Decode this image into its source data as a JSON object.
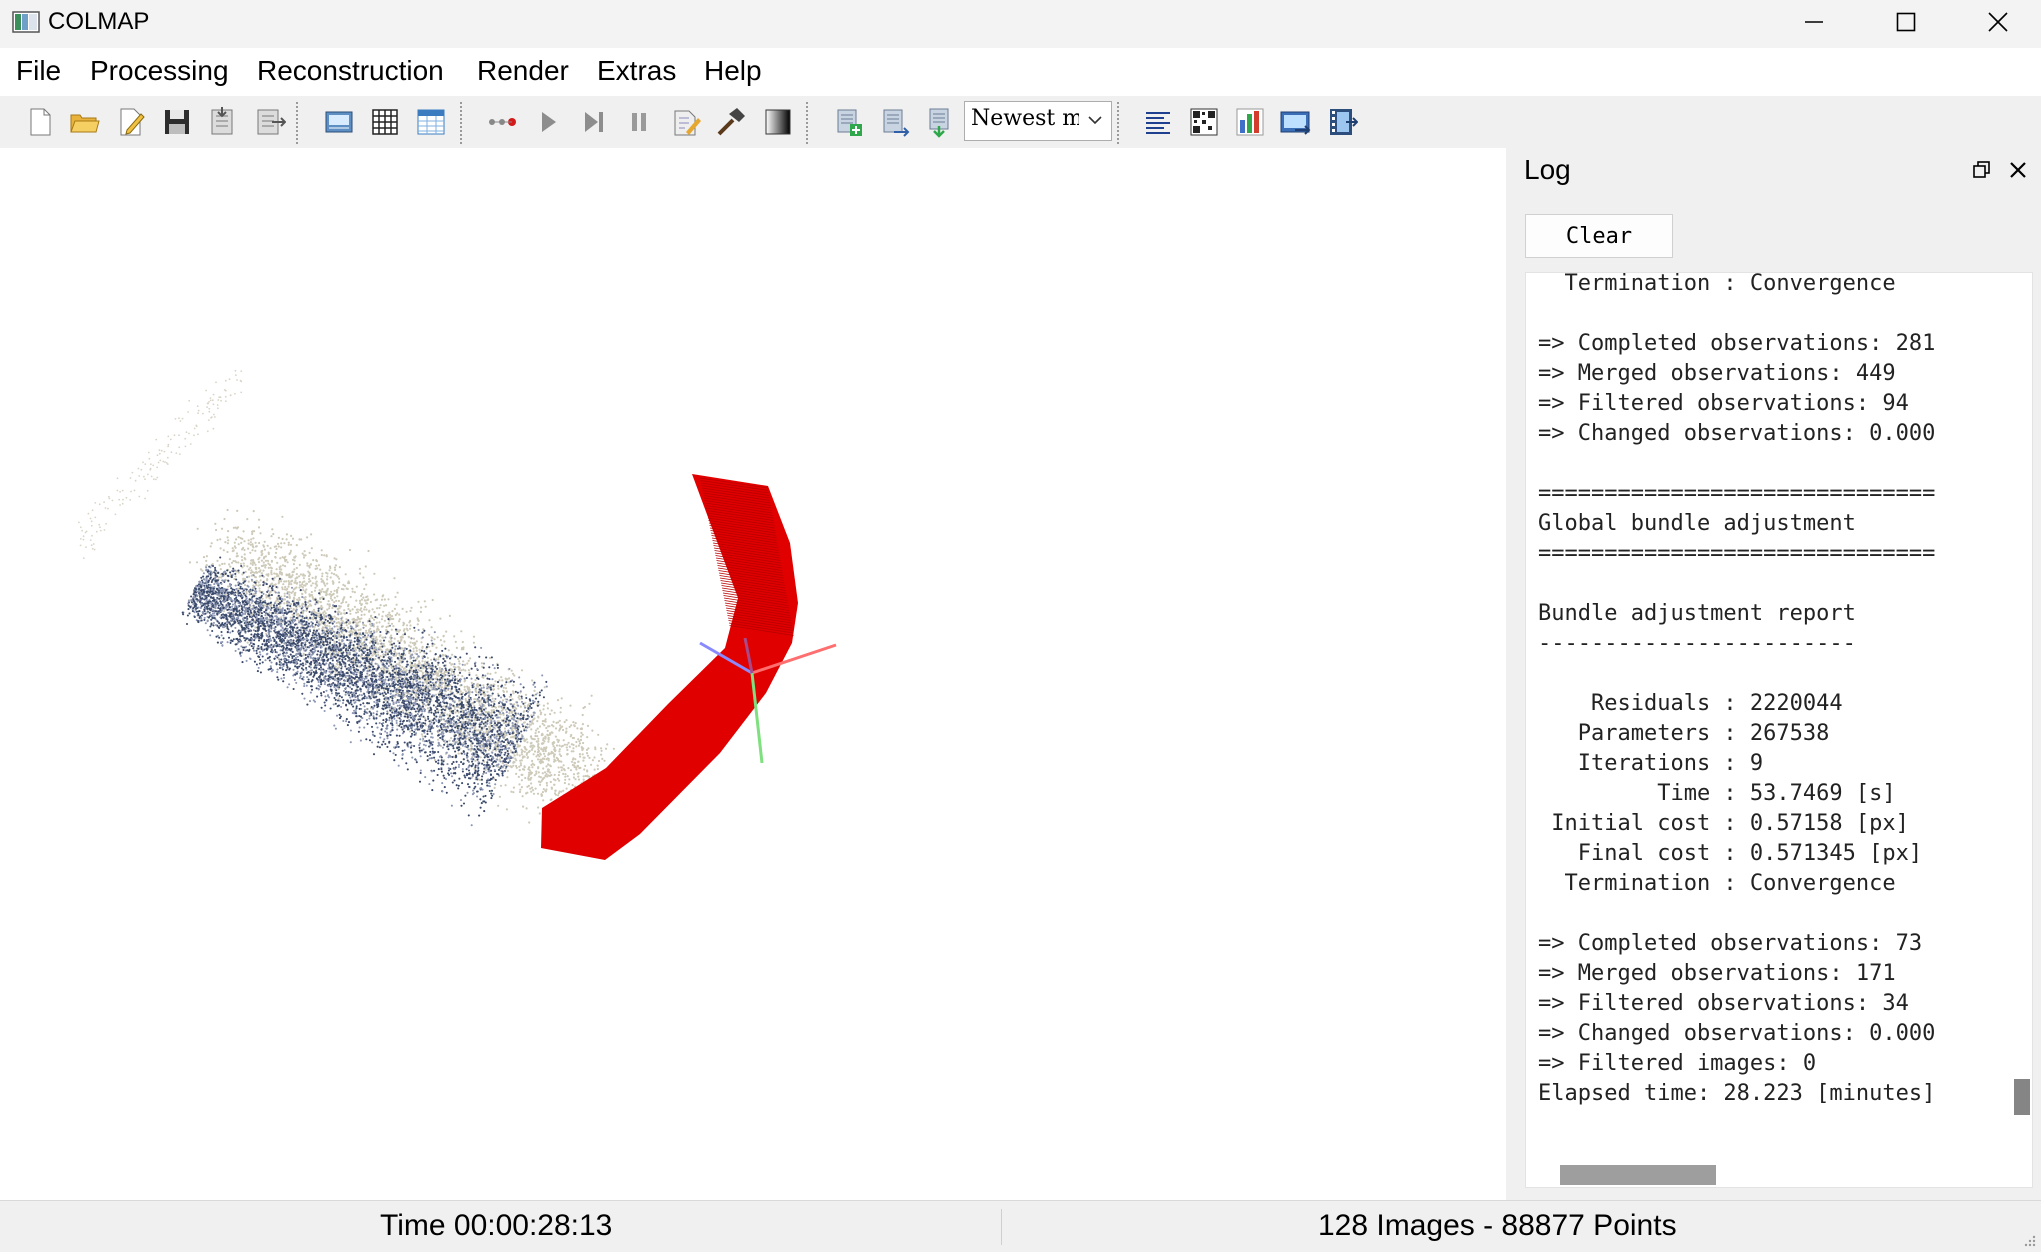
{
  "window": {
    "title": "COLMAP",
    "icons": [
      "app-icon",
      "minimize-icon",
      "maximize-icon",
      "close-icon"
    ]
  },
  "menu": {
    "items": [
      "File",
      "Processing",
      "Reconstruction",
      "Render",
      "Extras",
      "Help"
    ]
  },
  "toolbar": {
    "icons": [
      "new-project-icon",
      "open-project-icon",
      "edit-project-icon",
      "save-project-icon",
      "import-model-icon",
      "export-model-icon",
      "feature-extraction-icon",
      "feature-matching-icon",
      "database-management-icon",
      "reconstruction-start-icon",
      "reconstruction-step-icon",
      "reconstruction-pause-icon",
      "reconstruction-reset-icon",
      "bundle-adjustment-icon",
      "dense-reconstruction-icon",
      "render-toggle-icon",
      "add-model-icon",
      "reset-model-icon",
      "delete-model-icon",
      "log-icon",
      "match-matrix-icon",
      "statistics-icon",
      "grab-image-icon",
      "grab-movie-icon"
    ],
    "model_select": {
      "value": "Newest model"
    }
  },
  "viewport": {
    "point_cloud_colors": [
      "#3b4a6b",
      "#8e98b4",
      "#cdcab9"
    ],
    "camera_path_color": "#e00000",
    "axes_colors": {
      "x": "#ff6f6f",
      "y": "#7ee07e",
      "z": "#8a8aff"
    }
  },
  "log": {
    "title": "Log",
    "clear_label": "Clear",
    "lines": [
      "  Termination : Convergence",
      "",
      "=> Completed observations: 281",
      "=> Merged observations: 449",
      "=> Filtered observations: 94",
      "=> Changed observations: 0.000",
      "",
      "==============================",
      "Global bundle adjustment",
      "==============================",
      "",
      "Bundle adjustment report",
      "------------------------",
      "",
      "    Residuals : 2220044",
      "   Parameters : 267538",
      "   Iterations : 9",
      "         Time : 53.7469 [s]",
      " Initial cost : 0.57158 [px]",
      "   Final cost : 0.571345 [px]",
      "  Termination : Convergence",
      "",
      "=> Completed observations: 73",
      "=> Merged observations: 171",
      "=> Filtered observations: 34",
      "=> Changed observations: 0.000",
      "=> Filtered images: 0",
      "Elapsed time: 28.223 [minutes]"
    ]
  },
  "status": {
    "time": "Time 00:00:28:13",
    "summary": "128 Images - 88877 Points"
  }
}
